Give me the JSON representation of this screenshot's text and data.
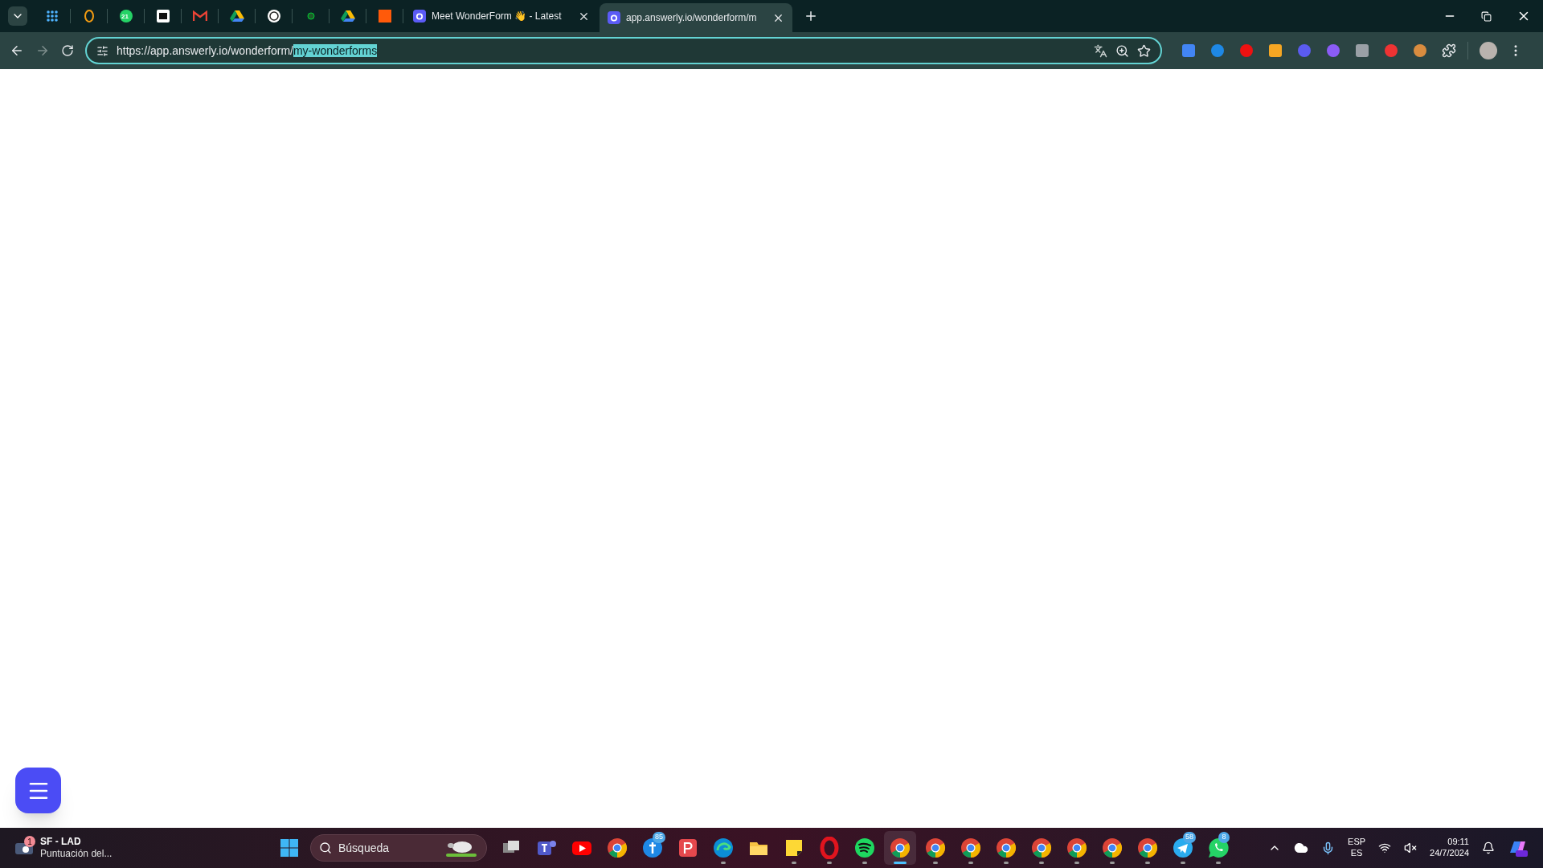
{
  "tab_strip": {
    "pinned_tabs": [
      {
        "kind": "grid"
      },
      {
        "kind": "ring"
      },
      {
        "kind": "chat",
        "badge": "21"
      },
      {
        "kind": "square-dark"
      },
      {
        "kind": "mail"
      },
      {
        "kind": "drive"
      },
      {
        "kind": "swirl"
      },
      {
        "kind": "dot"
      },
      {
        "kind": "drive"
      },
      {
        "kind": "square-orange"
      }
    ],
    "tabs": [
      {
        "title": "Meet WonderForm 👋 - Latest",
        "selected": false
      },
      {
        "title": "app.answerly.io/wonderform/m",
        "selected": true
      }
    ]
  },
  "address_bar": {
    "url": "https://app.answerly.io/wonderform/",
    "selected_text": "my-wonderforms",
    "focused": true
  },
  "taskbar": {
    "widget": {
      "badge": "1",
      "title": "SF - LAD",
      "subtitle": "Puntuación del..."
    },
    "search": {
      "placeholder": "Búsqueda"
    },
    "apps": [
      {
        "kind": "taskview",
        "running": false,
        "selected": false
      },
      {
        "kind": "teams",
        "running": false,
        "selected": false
      },
      {
        "kind": "youtube",
        "running": false,
        "selected": false
      },
      {
        "kind": "chrome",
        "running": false,
        "selected": false
      },
      {
        "kind": "cross",
        "badge": "85",
        "running": false,
        "selected": false
      },
      {
        "kind": "pdf",
        "running": false,
        "selected": false
      },
      {
        "kind": "edge",
        "running": true,
        "selected": false
      },
      {
        "kind": "folder",
        "running": false,
        "selected": false
      },
      {
        "kind": "sticky",
        "running": true,
        "selected": false
      },
      {
        "kind": "opera",
        "running": true,
        "selected": false
      },
      {
        "kind": "spotify",
        "running": true,
        "selected": false
      },
      {
        "kind": "chrome",
        "running": true,
        "selected": true
      },
      {
        "kind": "chrome",
        "running": true,
        "selected": false
      },
      {
        "kind": "chrome",
        "running": true,
        "selected": false
      },
      {
        "kind": "chrome",
        "running": true,
        "selected": false
      },
      {
        "kind": "chrome",
        "running": true,
        "selected": false
      },
      {
        "kind": "chrome",
        "running": true,
        "selected": false
      },
      {
        "kind": "chrome",
        "running": true,
        "selected": false
      },
      {
        "kind": "chrome",
        "running": true,
        "selected": false
      },
      {
        "kind": "telegram",
        "badge": "58",
        "running": true,
        "selected": false
      },
      {
        "kind": "whatsapp",
        "badge": "8",
        "running": true,
        "selected": false
      }
    ],
    "tray": {
      "language": "ESP",
      "layout": "ES",
      "time": "09:11",
      "date": "24/7/2024"
    }
  }
}
